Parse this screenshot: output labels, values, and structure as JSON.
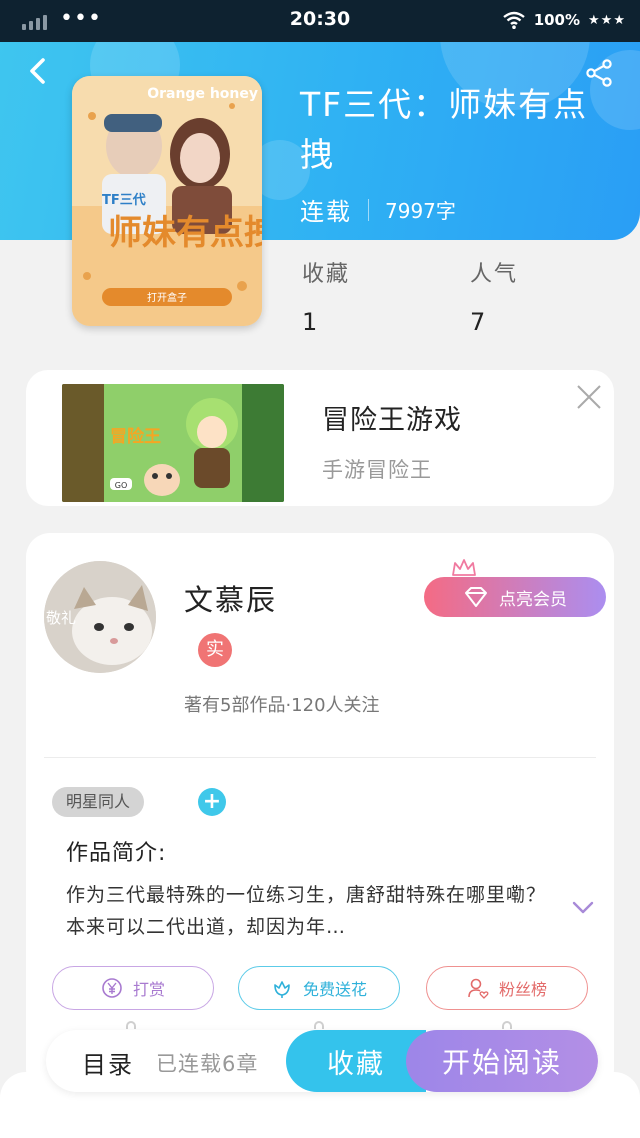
{
  "status_bar": {
    "time": "20:30",
    "battery": "100%",
    "dots": "•••",
    "stars": "★★★"
  },
  "book": {
    "title": "TF三代：师妹有点拽",
    "status": "连载",
    "word_count": "7997字",
    "cover_badge": "TF三代",
    "cover_title": "师妹有点拽",
    "cover_tagline": "打开盒子",
    "cover_bottom_text": "打开盒子",
    "cover_corner_text": "Orange honey"
  },
  "stats": [
    {
      "label": "收藏",
      "value": "1"
    },
    {
      "label": "人气",
      "value": "7"
    }
  ],
  "ad": {
    "title": "冒险王游戏",
    "subtitle": "手游冒险王",
    "game_logo": "冒险王",
    "go_label": "GO"
  },
  "author": {
    "name": "文慕辰",
    "avatar_caption": "敬礼",
    "verified_label": "实",
    "summary": "著有5部作品·120人关注",
    "vip_button": "点亮会员"
  },
  "tags": {
    "category": "明星同人",
    "add_symbol": "+"
  },
  "intro": {
    "heading": "作品简介:",
    "text": "作为三代最特殊的一位练习生，唐舒甜特殊在哪里嘞？本来可以二代出道，却因为年…"
  },
  "actions": {
    "reward": "打赏",
    "flower": "免费送花",
    "fans": "粉丝榜"
  },
  "bottom": {
    "toc": "目录",
    "chapters": "已连载6章",
    "collect": "收藏",
    "read": "开始阅读"
  },
  "colors": {
    "header": "#2fb1f3",
    "accent": "#34c3ec",
    "read_button": "#a98ae8",
    "vip": "#f46b84"
  }
}
